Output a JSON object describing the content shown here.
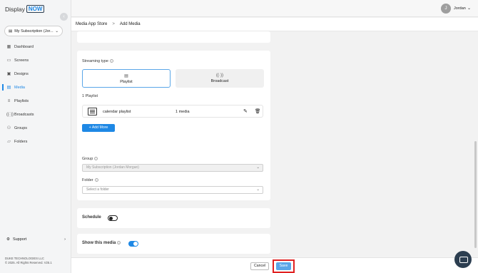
{
  "brand": {
    "name": "Display",
    "highlight": "NOW"
  },
  "subscription": {
    "label": "My Subscription (Jor..."
  },
  "nav": [
    {
      "label": "Dashboard",
      "icon": "dashboard-icon",
      "glyph": "▦"
    },
    {
      "label": "Screens",
      "icon": "screens-icon",
      "glyph": "▭"
    },
    {
      "label": "Designs",
      "icon": "designs-icon",
      "glyph": "▣"
    },
    {
      "label": "Media",
      "icon": "media-icon",
      "glyph": "▤",
      "active": true
    },
    {
      "label": "Playlists",
      "icon": "playlists-icon",
      "glyph": "≡"
    },
    {
      "label": "Broadcasts",
      "icon": "broadcasts-icon",
      "glyph": "((•))"
    },
    {
      "label": "Groups",
      "icon": "groups-icon",
      "glyph": "⚇"
    },
    {
      "label": "Folders",
      "icon": "folders-icon",
      "glyph": "▱"
    }
  ],
  "support": {
    "label": "Support"
  },
  "footer": {
    "company": "DUKE TECHNOLOGIES LLC",
    "copyright": "© 2025. All Rights Reserved. V25.1"
  },
  "user": {
    "initial": "J",
    "name": "Jordan"
  },
  "breadcrumb": {
    "parent": "Media App Store",
    "separator": ">",
    "current": "Add Media"
  },
  "streaming": {
    "title": "Streaming type",
    "options": [
      {
        "label": "Playlist",
        "selected": true
      },
      {
        "label": "Broadcast",
        "selected": false
      }
    ],
    "count_label": "1 Playlist",
    "playlist": {
      "name": "calendar playlist",
      "count": "1 media"
    },
    "add_more": "+ Add More"
  },
  "group": {
    "label": "Group",
    "value": "My Subscription (Jordan Morgan)"
  },
  "folder": {
    "label": "Folder",
    "placeholder": "Select a folder"
  },
  "schedule": {
    "label": "Schedule",
    "enabled": false
  },
  "show_media": {
    "label": "Show this media",
    "enabled": true
  },
  "actions": {
    "cancel": "Cancel",
    "save": "Save"
  },
  "colors": {
    "accent": "#1e88e5",
    "highlight": "#e02020"
  }
}
